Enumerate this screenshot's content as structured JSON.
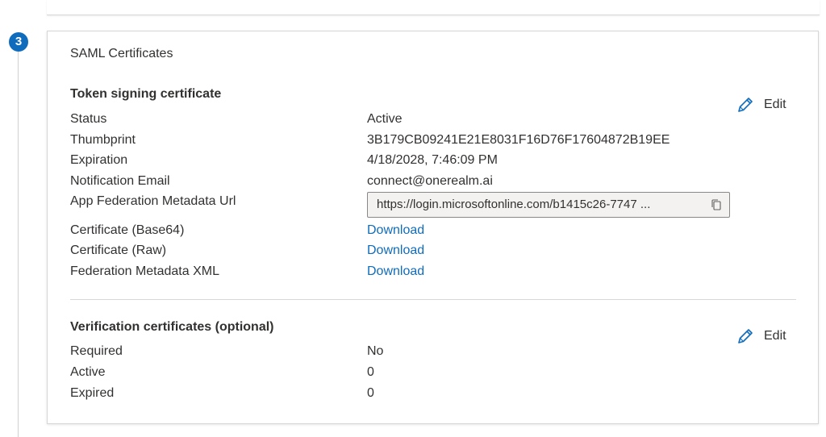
{
  "step": {
    "number": "3"
  },
  "card": {
    "title": "SAML Certificates",
    "token_signing": {
      "heading": "Token signing certificate",
      "edit_label": "Edit",
      "rows": {
        "status": {
          "label": "Status",
          "value": "Active"
        },
        "thumbprint": {
          "label": "Thumbprint",
          "value": "3B179CB09241E21E8031F16D76F17604872B19EE"
        },
        "expiration": {
          "label": "Expiration",
          "value": "4/18/2028, 7:46:09 PM"
        },
        "notification_email": {
          "label": "Notification Email",
          "value": "connect@onerealm.ai"
        },
        "metadata_url": {
          "label": "App Federation Metadata Url",
          "value": "https://login.microsoftonline.com/b1415c26-7747 ..."
        },
        "cert_base64": {
          "label": "Certificate (Base64)",
          "link": "Download"
        },
        "cert_raw": {
          "label": "Certificate (Raw)",
          "link": "Download"
        },
        "federation_xml": {
          "label": "Federation Metadata XML",
          "link": "Download"
        }
      }
    },
    "verification": {
      "heading": "Verification certificates (optional)",
      "edit_label": "Edit",
      "rows": {
        "required": {
          "label": "Required",
          "value": "No"
        },
        "active": {
          "label": "Active",
          "value": "0"
        },
        "expired": {
          "label": "Expired",
          "value": "0"
        }
      }
    }
  },
  "icons": {
    "edit": "pencil-icon",
    "copy": "copy-icon"
  },
  "colors": {
    "accent": "#0f6cbd",
    "text": "#323130",
    "border": "#d6d6d6"
  }
}
